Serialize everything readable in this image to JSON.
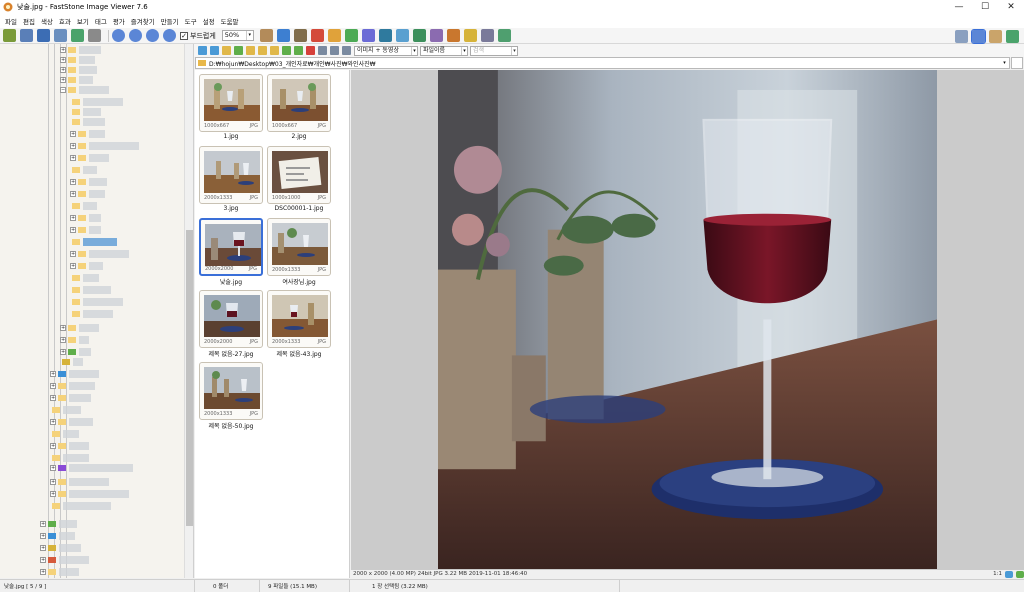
{
  "window": {
    "title": "낮술.jpg  -  FastStone Image Viewer 7.6",
    "minimize_glyph": "—",
    "maximize_glyph": "☐",
    "close_glyph": "✕"
  },
  "menu": [
    "파일",
    "편집",
    "색상",
    "효과",
    "보기",
    "태그",
    "평가",
    "즐겨찾기",
    "만들기",
    "도구",
    "설정",
    "도움말"
  ],
  "toolbar": {
    "smooth_label": "부드럽게",
    "smooth_checked": "✓",
    "zoom_value": "50%",
    "dropdown_glyph": "▾"
  },
  "file_toolbar": {
    "view_mode": "이미지 + 동영상",
    "sort_mode": "파일이름",
    "search_placeholder": "검색"
  },
  "path": "D:₩hojun₩Desktop₩03_개인자료₩개인₩사진₩와인사진₩",
  "thumbnails": [
    {
      "name": "1.jpg",
      "size": "1000x667",
      "type": "JPG"
    },
    {
      "name": "2.jpg",
      "size": "1000x667",
      "type": "JPG"
    },
    {
      "name": "3.jpg",
      "size": "2000x1333",
      "type": "JPG"
    },
    {
      "name": "DSC00001-1.jpg",
      "size": "1000x1000",
      "type": "JPG"
    },
    {
      "name": "낮술.jpg",
      "size": "2000x2000",
      "type": "JPG"
    },
    {
      "name": "여사장님.jpg",
      "size": "2000x1333",
      "type": "JPG"
    },
    {
      "name": "제목 없음-27.jpg",
      "size": "2000x2000",
      "type": "JPG"
    },
    {
      "name": "제목 없음-43.jpg",
      "size": "2000x1333",
      "type": "JPG"
    },
    {
      "name": "제목 없음-50.jpg",
      "size": "2000x1333",
      "type": "JPG"
    }
  ],
  "image_info": "2000 x 2000 (4.00 MP)  24bit  JPG   3.22 MB   2019-11-01 18:46:40",
  "image_zoom": "1:1",
  "status": {
    "file": "낮술.jpg [ 5 / 9 ]",
    "folders": "0 폴더",
    "files": "9 파일들 (15.1 MB)",
    "selected": "1 장 선택됨 (3.22 MB)"
  },
  "colors": {
    "selection_border": "#3a6fd8",
    "viewer_background": "#cbcbcb",
    "folder_yellow": "#f5d27a"
  }
}
